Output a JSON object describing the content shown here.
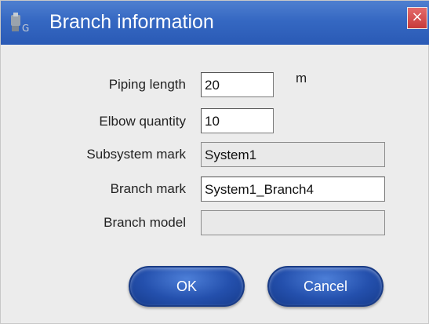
{
  "window": {
    "title": "Branch information",
    "close_glyph": "×",
    "app_icon": "software-logo-icon",
    "close_icon": "close-icon",
    "titlebar_color": "#3568c2",
    "close_color": "#d04848"
  },
  "form": {
    "piping_length": {
      "label": "Piping length",
      "value": "20",
      "unit": "m"
    },
    "elbow_quantity": {
      "label": "Elbow quantity",
      "value": "10"
    },
    "subsystem_mark": {
      "label": "Subsystem mark",
      "value": "System1"
    },
    "branch_mark": {
      "label": "Branch mark",
      "value": "System1_Branch4"
    },
    "branch_model": {
      "label": "Branch model",
      "value": ""
    }
  },
  "buttons": {
    "ok": "OK",
    "cancel": "Cancel",
    "color": "#2450ad"
  }
}
